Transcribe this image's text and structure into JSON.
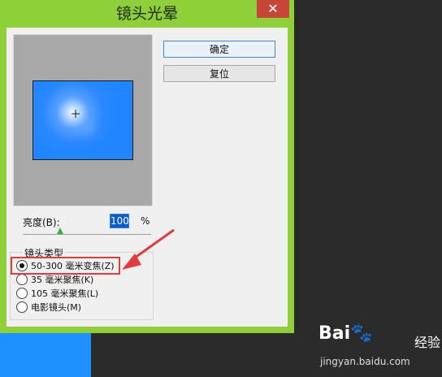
{
  "window": {
    "title": "镜头光晕",
    "close_glyph": "✕"
  },
  "buttons": {
    "ok_label": "确定",
    "reset_label": "复位"
  },
  "brightness": {
    "label": "亮度(B):",
    "value": "100",
    "unit": "%",
    "slider_value_percent": 100
  },
  "lens_group": {
    "title": "镜头类型",
    "options": [
      {
        "label": "50-300 毫米变焦(Z)",
        "selected": true
      },
      {
        "label": "35 毫米聚焦(K)",
        "selected": false
      },
      {
        "label": "105 毫米聚焦(L)",
        "selected": false
      },
      {
        "label": "电影镜头(M)",
        "selected": false
      }
    ]
  },
  "watermark": {
    "brand": "Bai🐾",
    "suffix": "经验",
    "url": "jingyan.baidu.com"
  },
  "colors": {
    "accent_blue": "#1f86ff",
    "frame_green": "#8fcf3a",
    "highlight_red": "#e23b3b",
    "close_red": "#c7463a"
  },
  "icons": {
    "cursor": "crosshair-icon",
    "annotation": "red-arrow-icon"
  }
}
